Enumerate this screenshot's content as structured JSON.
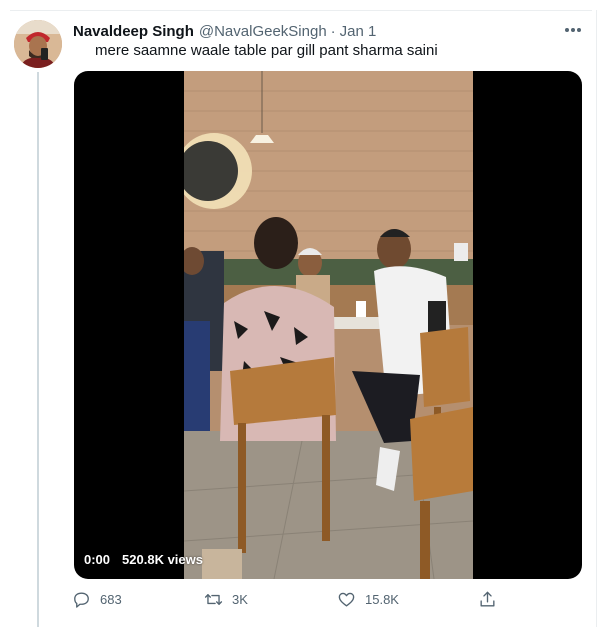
{
  "tweet": {
    "author": {
      "display_name": "Navaldeep Singh",
      "handle": "@NavalGeekSingh",
      "separator": "·",
      "date": "Jan 1"
    },
    "text": "mere saamne waale table par gill pant sharma saini",
    "video": {
      "time": "0:00",
      "views": "520.8K views"
    },
    "actions": {
      "replies": "683",
      "retweets": "3K",
      "likes": "15.8K"
    }
  },
  "icons": {
    "more": "more-horizontal-icon",
    "reply": "speech-bubble-icon",
    "retweet": "retweet-arrows-icon",
    "like": "heart-icon",
    "share": "share-upload-icon"
  },
  "colors": {
    "secondary_text": "#536471",
    "divider": "#ebeef0",
    "thread_line": "#cfd9de",
    "media_background": "#000000"
  }
}
